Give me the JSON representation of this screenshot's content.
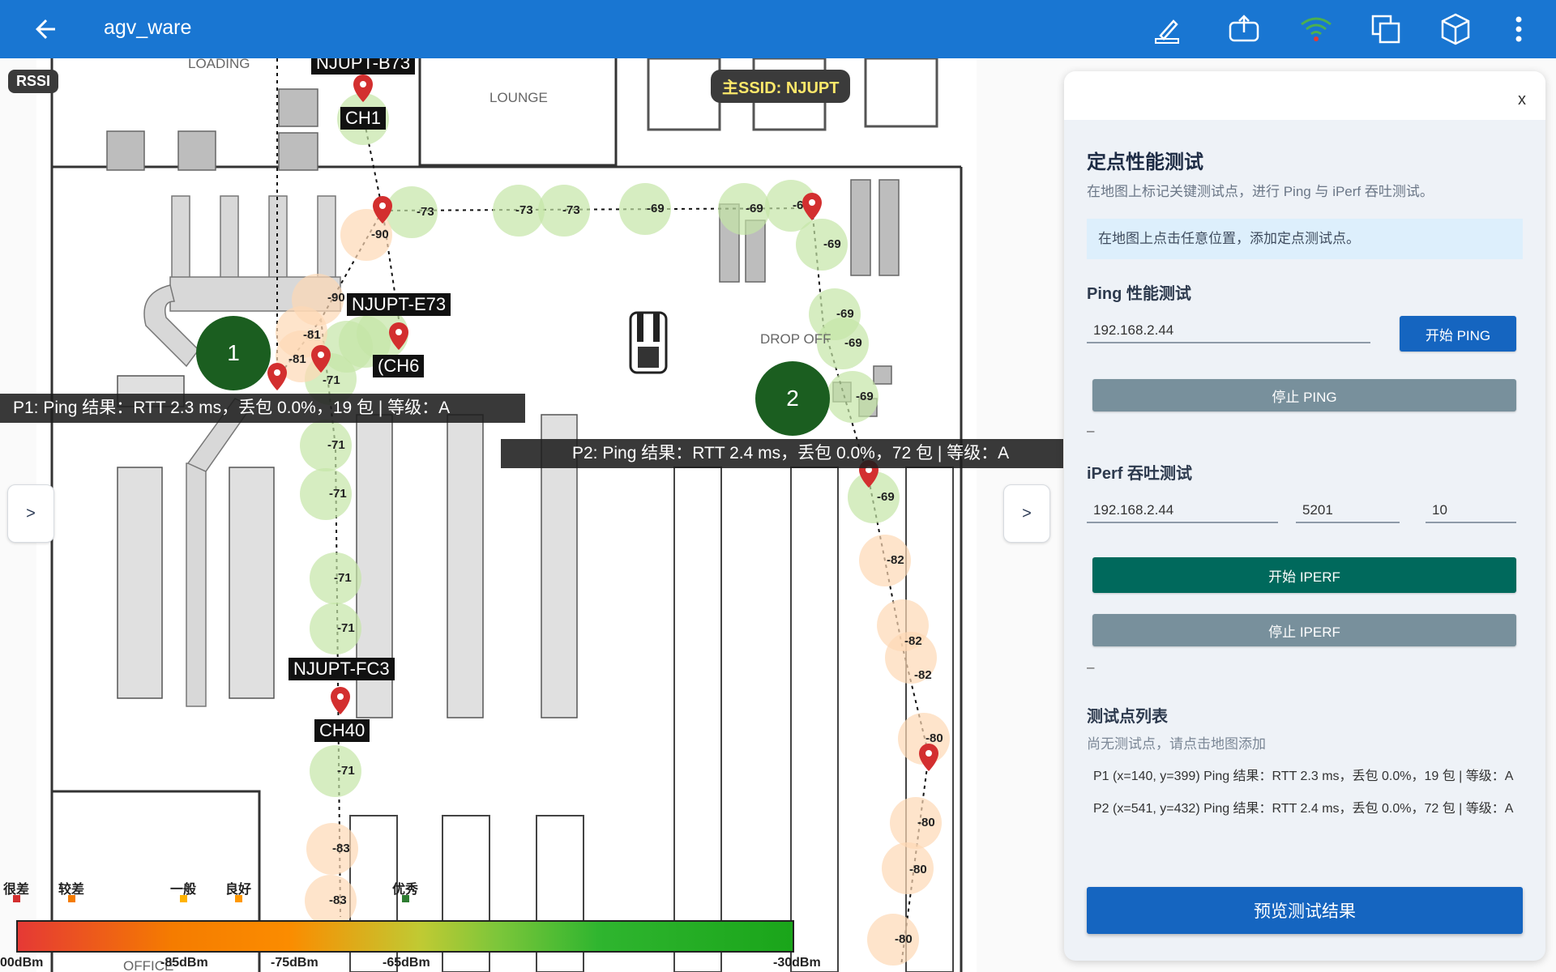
{
  "appbar": {
    "title": "agv_ware",
    "actions": [
      "ruler-pencil-icon",
      "upload-icon",
      "wifi-icon",
      "copy-layers-icon",
      "cube-icon",
      "more-vert-icon"
    ]
  },
  "map": {
    "rssi_tag": "RSSI",
    "ssid_tag": "主SSID: NJUPT",
    "room_labels": {
      "loading": "LOADING",
      "lounge": "LOUNGE",
      "drop_off": "DROP OFF",
      "office": "OFFICE"
    },
    "ap_labels": {
      "b73": "NJUPT-B73",
      "ch1": "CH1",
      "e73": "NJUPT-E73",
      "ch6": "(CH6",
      "fc3": "NJUPT-FC3",
      "ch40": "CH40"
    },
    "points": [
      {
        "id": "1",
        "label": "1"
      },
      {
        "id": "2",
        "label": "2"
      }
    ],
    "banners": {
      "p1": "P1: Ping 结果：RTT 2.3 ms，丢包 0.0%，19 包 | 等级：A",
      "p2": "P2: Ping 结果：RTT 2.4 ms，丢包 0.0%，72 包 | 等级：A"
    },
    "side_left": ">",
    "side_right": ">",
    "samples": [
      {
        "v": "-90",
        "c": "orange"
      },
      {
        "v": "-73",
        "c": "green"
      },
      {
        "v": "-73",
        "c": "green"
      },
      {
        "v": "-73",
        "c": "green"
      },
      {
        "v": "-69",
        "c": "green"
      },
      {
        "v": "-69",
        "c": "green"
      },
      {
        "v": "-6",
        "c": "green"
      },
      {
        "v": "-69",
        "c": "green"
      },
      {
        "v": "-90",
        "c": "orange"
      },
      {
        "v": "-81",
        "c": "orange"
      },
      {
        "v": "-81",
        "c": "orange"
      },
      {
        "v": "-71",
        "c": "green"
      },
      {
        "v": "-71",
        "c": "green"
      },
      {
        "v": "-71",
        "c": "green"
      },
      {
        "v": "-71",
        "c": "green"
      },
      {
        "v": "-71",
        "c": "green"
      },
      {
        "v": "-71",
        "c": "green"
      },
      {
        "v": "-71",
        "c": "green"
      },
      {
        "v": "-83",
        "c": "orange"
      },
      {
        "v": "-83",
        "c": "orange"
      },
      {
        "v": "-69",
        "c": "green"
      },
      {
        "v": "-69",
        "c": "green"
      },
      {
        "v": "-69",
        "c": "green"
      },
      {
        "v": "-69",
        "c": "green"
      },
      {
        "v": "-82",
        "c": "orange"
      },
      {
        "v": "-82",
        "c": "orange"
      },
      {
        "v": "-82",
        "c": "orange"
      },
      {
        "v": "-80",
        "c": "orange"
      },
      {
        "v": "-80",
        "c": "orange"
      },
      {
        "v": "-80",
        "c": "orange"
      },
      {
        "v": "-80",
        "c": "orange"
      },
      {
        "v": "-80",
        "c": "orange"
      }
    ]
  },
  "legend": {
    "quality": [
      "很差",
      "较差",
      "一般",
      "良好",
      "优秀"
    ],
    "quality_colors": [
      "#d32f2f",
      "#f57c00",
      "#ffb300",
      "#ff9800",
      "#2e7d32"
    ],
    "ticks": [
      "00dBm",
      "-85dBm",
      "-75dBm",
      "-65dBm",
      "-30dBm"
    ]
  },
  "panel": {
    "close": "x",
    "title": "定点性能测试",
    "subtitle": "在地图上标记关键测试点，进行 Ping 与 iPerf 吞吐测试。",
    "hint": "在地图上点击任意位置，添加定点测试点。",
    "ping": {
      "section": "Ping 性能测试",
      "host": "192.168.2.44",
      "start": "开始 PING",
      "stop": "停止 PING",
      "result": "–"
    },
    "iperf": {
      "section": "iPerf 吞吐测试",
      "host": "192.168.2.44",
      "port": "5201",
      "duration": "10",
      "start": "开始 IPERF",
      "stop": "停止 IPERF",
      "result": "–"
    },
    "list": {
      "section": "测试点列表",
      "empty_hint": "尚无测试点，请点击地图添加",
      "rows": [
        "P1 (x=140, y=399) Ping 结果：RTT 2.3 ms，丢包 0.0%，19 包 | 等级：A",
        "P2 (x=541, y=432) Ping 结果：RTT 2.4 ms，丢包 0.0%，72 包 | 等级：A"
      ]
    },
    "preview": "预览测试结果"
  },
  "colors": {
    "appbar": "#1976d2",
    "start_ping": "#1565c0",
    "start_iperf": "#00695c",
    "stop_btn": "#78909c",
    "point_green": "#1b5e20",
    "marker_red": "#d32f2f"
  }
}
